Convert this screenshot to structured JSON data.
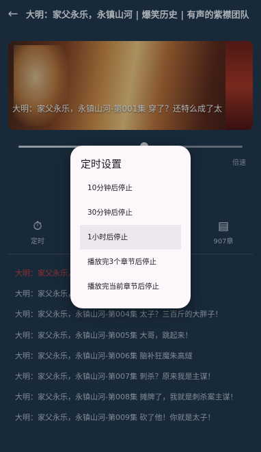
{
  "header": {
    "back_icon": "arrow-left-icon",
    "title": "大明：家父永乐，永镇山河 | 爆笑历史 | 有声的紫襟团队"
  },
  "player": {
    "now_playing": "大明：家父永乐，永镇山河-第001集 穿了？还特么成了太",
    "progress": 0.56,
    "speed_label": "倍速"
  },
  "controls": [
    {
      "icon": "timer-icon",
      "label": "定时"
    },
    {
      "icon": "playlist-icon",
      "label": "907章"
    }
  ],
  "episodes": [
    {
      "text": "大明：家父永乐，永镇山河-第002集 ...",
      "active": true
    },
    {
      "text": "大明：家父永乐，永镇山河-第003集 骗，接着骗！",
      "active": false
    },
    {
      "text": "大明：家父永乐，永镇山河-第004集 太子？三百斤的大胖子！",
      "active": false
    },
    {
      "text": "大明：家父永乐，永镇山河-第005集 大哥，跳起来！",
      "active": false
    },
    {
      "text": "大明：家父永乐，永镇山河-第006集 脑补狂魔朱高燧",
      "active": false
    },
    {
      "text": "大明：家父永乐，永镇山河-第007集 刺杀？原来我是主谋！",
      "active": false
    },
    {
      "text": "大明：家父永乐，永镇山河-第008集 摊牌了，我就是刺杀案主谋！",
      "active": false
    },
    {
      "text": "大明：家父永乐，永镇山河-第009集 砍了他！你就是太子！",
      "active": false
    }
  ],
  "timer_dialog": {
    "title": "定时设置",
    "options": [
      {
        "label": "10分钟后停止",
        "selected": false
      },
      {
        "label": "30分钟后停止",
        "selected": false
      },
      {
        "label": "1小时后停止",
        "selected": true
      },
      {
        "label": "播放完3个章节后停止",
        "selected": false
      },
      {
        "label": "播放完当前章节后停止",
        "selected": false
      }
    ]
  },
  "colors": {
    "background": "#1e3144",
    "active_episode": "#c33a3a",
    "dialog_bg": "#fdf6fb",
    "dialog_selected": "#ece6ee"
  }
}
